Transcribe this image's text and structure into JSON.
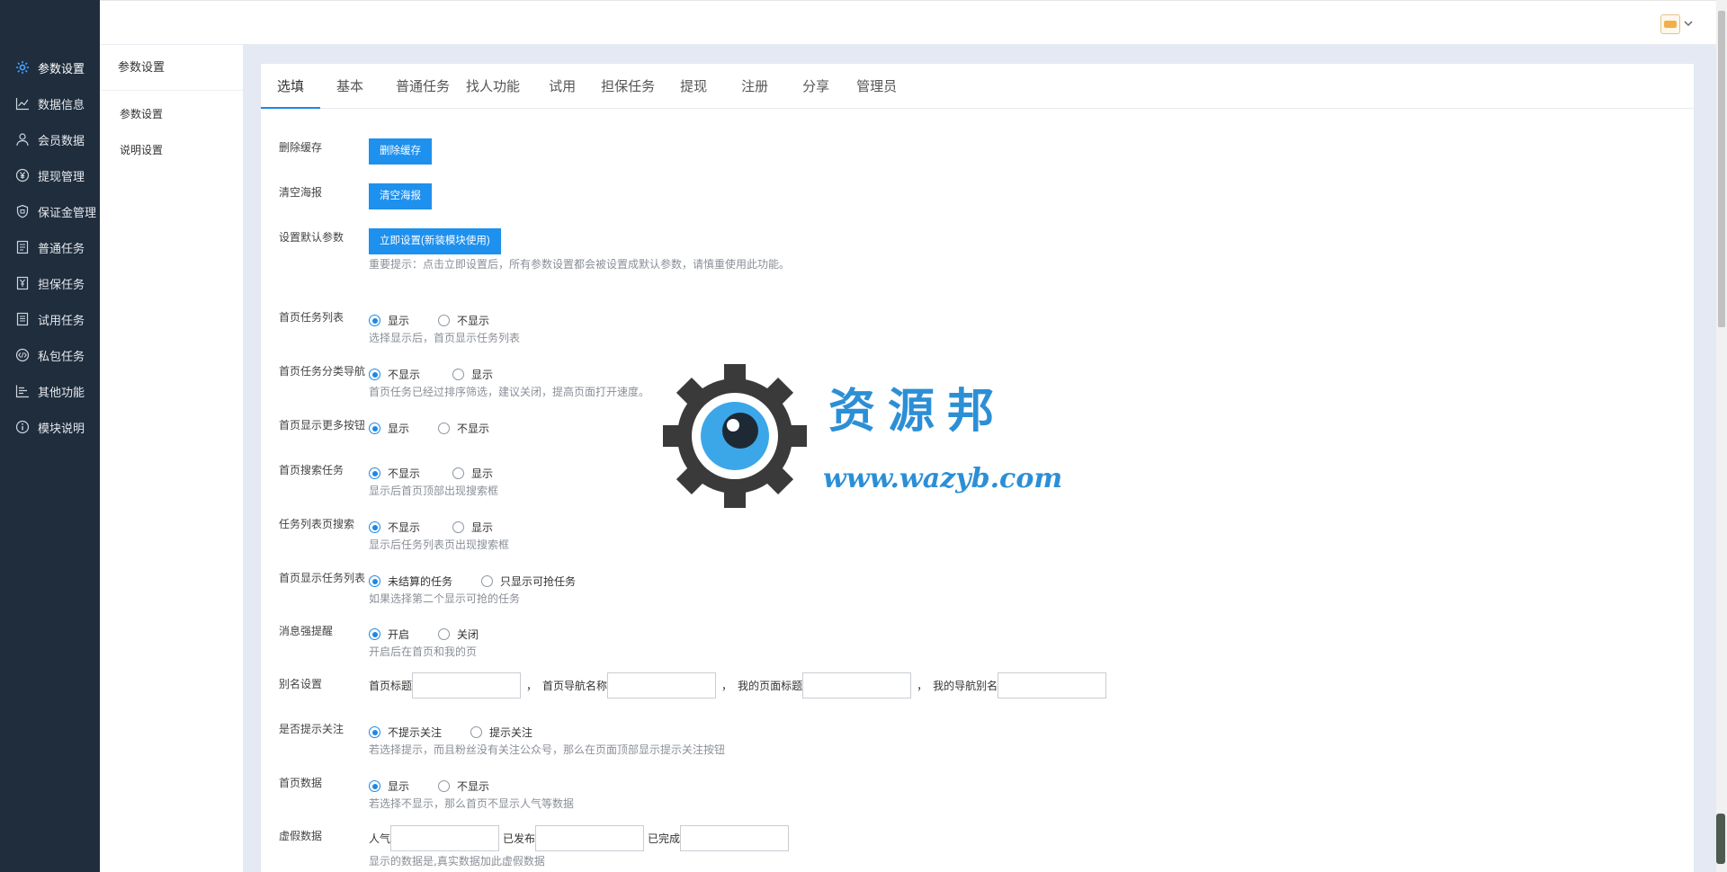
{
  "sidebar": {
    "items": [
      {
        "label": "参数设置",
        "icon": "gear-icon",
        "active": true
      },
      {
        "label": "数据信息",
        "icon": "line-chart-icon"
      },
      {
        "label": "会员数据",
        "icon": "user-icon"
      },
      {
        "label": "提现管理",
        "icon": "yen-icon"
      },
      {
        "label": "保证金管理",
        "icon": "shield-icon"
      },
      {
        "label": "普通任务",
        "icon": "document-icon"
      },
      {
        "label": "担保任务",
        "icon": "yen-doc-icon"
      },
      {
        "label": "试用任务",
        "icon": "list-doc-icon"
      },
      {
        "label": "私包任务",
        "icon": "code-icon"
      },
      {
        "label": "其他功能",
        "icon": "bars-icon"
      },
      {
        "label": "模块说明",
        "icon": "info-icon"
      }
    ]
  },
  "subsidebar": {
    "title": "参数设置",
    "items": [
      "参数设置",
      "说明设置"
    ]
  },
  "tabs": [
    "选填",
    "基本",
    "普通任务",
    "找人功能",
    "试用",
    "担保任务",
    "提现",
    "注册",
    "分享",
    "管理员"
  ],
  "form": {
    "delete_cache": {
      "label": "删除缓存",
      "button": "删除缓存"
    },
    "clear_poster": {
      "label": "清空海报",
      "button": "清空海报"
    },
    "default_params": {
      "label": "设置默认参数",
      "button": "立即设置(新装模块使用)",
      "hint": "重要提示：点击立即设置后，所有参数设置都会被设置成默认参数，请慎重使用此功能。"
    },
    "home_task_list": {
      "label": "首页任务列表",
      "opt1": "显示",
      "opt2": "不显示",
      "hint": "选择显示后，首页显示任务列表"
    },
    "home_task_nav": {
      "label": "首页任务分类导航",
      "opt1": "不显示",
      "opt2": "显示",
      "hint": "首页任务已经过排序筛选，建议关闭，提高页面打开速度。"
    },
    "home_more_btn": {
      "label": "首页显示更多按钮",
      "opt1": "显示",
      "opt2": "不显示"
    },
    "home_search": {
      "label": "首页搜索任务",
      "opt1": "不显示",
      "opt2": "显示",
      "hint": "显示后首页顶部出现搜索框"
    },
    "list_search": {
      "label": "任务列表页搜索",
      "opt1": "不显示",
      "opt2": "显示",
      "hint": "显示后任务列表页出现搜索框"
    },
    "home_list_type": {
      "label": "首页显示任务列表",
      "opt1": "未结算的任务",
      "opt2": "只显示可抢任务",
      "hint": "如果选择第二个显示可抢的任务"
    },
    "msg_remind": {
      "label": "消息强提醒",
      "opt1": "开启",
      "opt2": "关闭",
      "hint": "开启后在首页和我的页"
    },
    "alias": {
      "label": "别名设置",
      "f1": "首页标题",
      "f2": "首页导航名称",
      "f3": "我的页面标题",
      "f4": "我的导航别名",
      "comma": "，"
    },
    "follow_tip": {
      "label": "是否提示关注",
      "opt1": "不提示关注",
      "opt2": "提示关注",
      "hint": "若选择提示，而且粉丝没有关注公众号，那么在页面顶部显示提示关注按钮"
    },
    "home_data": {
      "label": "首页数据",
      "opt1": "显示",
      "opt2": "不显示",
      "hint": "若选择不显示，那么首页不显示人气等数据"
    },
    "fake_data": {
      "label": "虚假数据",
      "f1": "人气",
      "f2": "已发布",
      "f3": "已完成",
      "hint": "显示的数据是,真实数据加此虚假数据"
    }
  },
  "watermark": {
    "name": "资源邦",
    "url": "www.wazyb.com"
  },
  "colors": {
    "sidebar": "#1f2d3d",
    "accent": "#1e88e5",
    "button": "#1e90ee",
    "content_bg": "#e4e9f3"
  }
}
